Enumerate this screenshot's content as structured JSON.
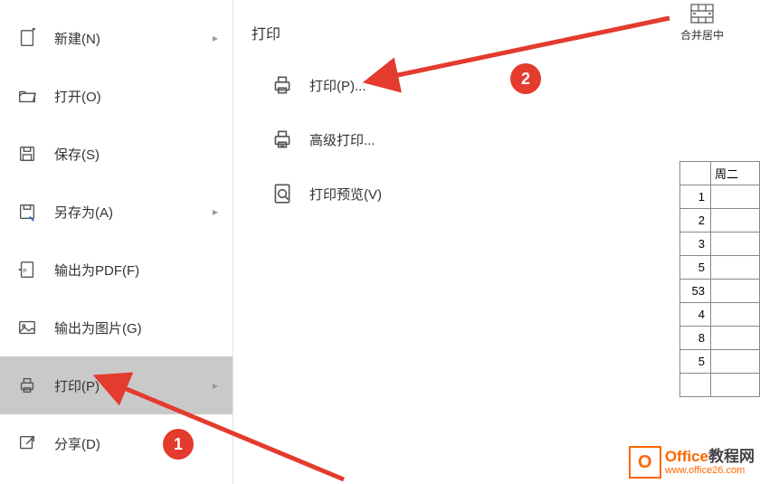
{
  "sidebar": {
    "items": [
      {
        "label": "新建(N)",
        "has_submenu": true
      },
      {
        "label": "打开(O)",
        "has_submenu": false
      },
      {
        "label": "保存(S)",
        "has_submenu": false
      },
      {
        "label": "另存为(A)",
        "has_submenu": true
      },
      {
        "label": "输出为PDF(F)",
        "has_submenu": false
      },
      {
        "label": "输出为图片(G)",
        "has_submenu": false
      },
      {
        "label": "打印(P)",
        "has_submenu": true,
        "active": true
      },
      {
        "label": "分享(D)",
        "has_submenu": false
      }
    ]
  },
  "submenu": {
    "title": "打印",
    "items": [
      {
        "label": "打印(P)..."
      },
      {
        "label": "高级打印..."
      },
      {
        "label": "打印预览(V)"
      }
    ]
  },
  "toolbar": {
    "merge_center": "合并居中"
  },
  "grid": {
    "header": "周二",
    "rows": [
      "1",
      "2",
      "3",
      "5",
      "53",
      "4",
      "8",
      "5",
      ""
    ]
  },
  "annotations": {
    "step1": "1",
    "step2": "2"
  },
  "watermark": {
    "logo_letter": "O",
    "title_en": "Office",
    "title_cn": "教程网",
    "url": "www.office26.com"
  }
}
